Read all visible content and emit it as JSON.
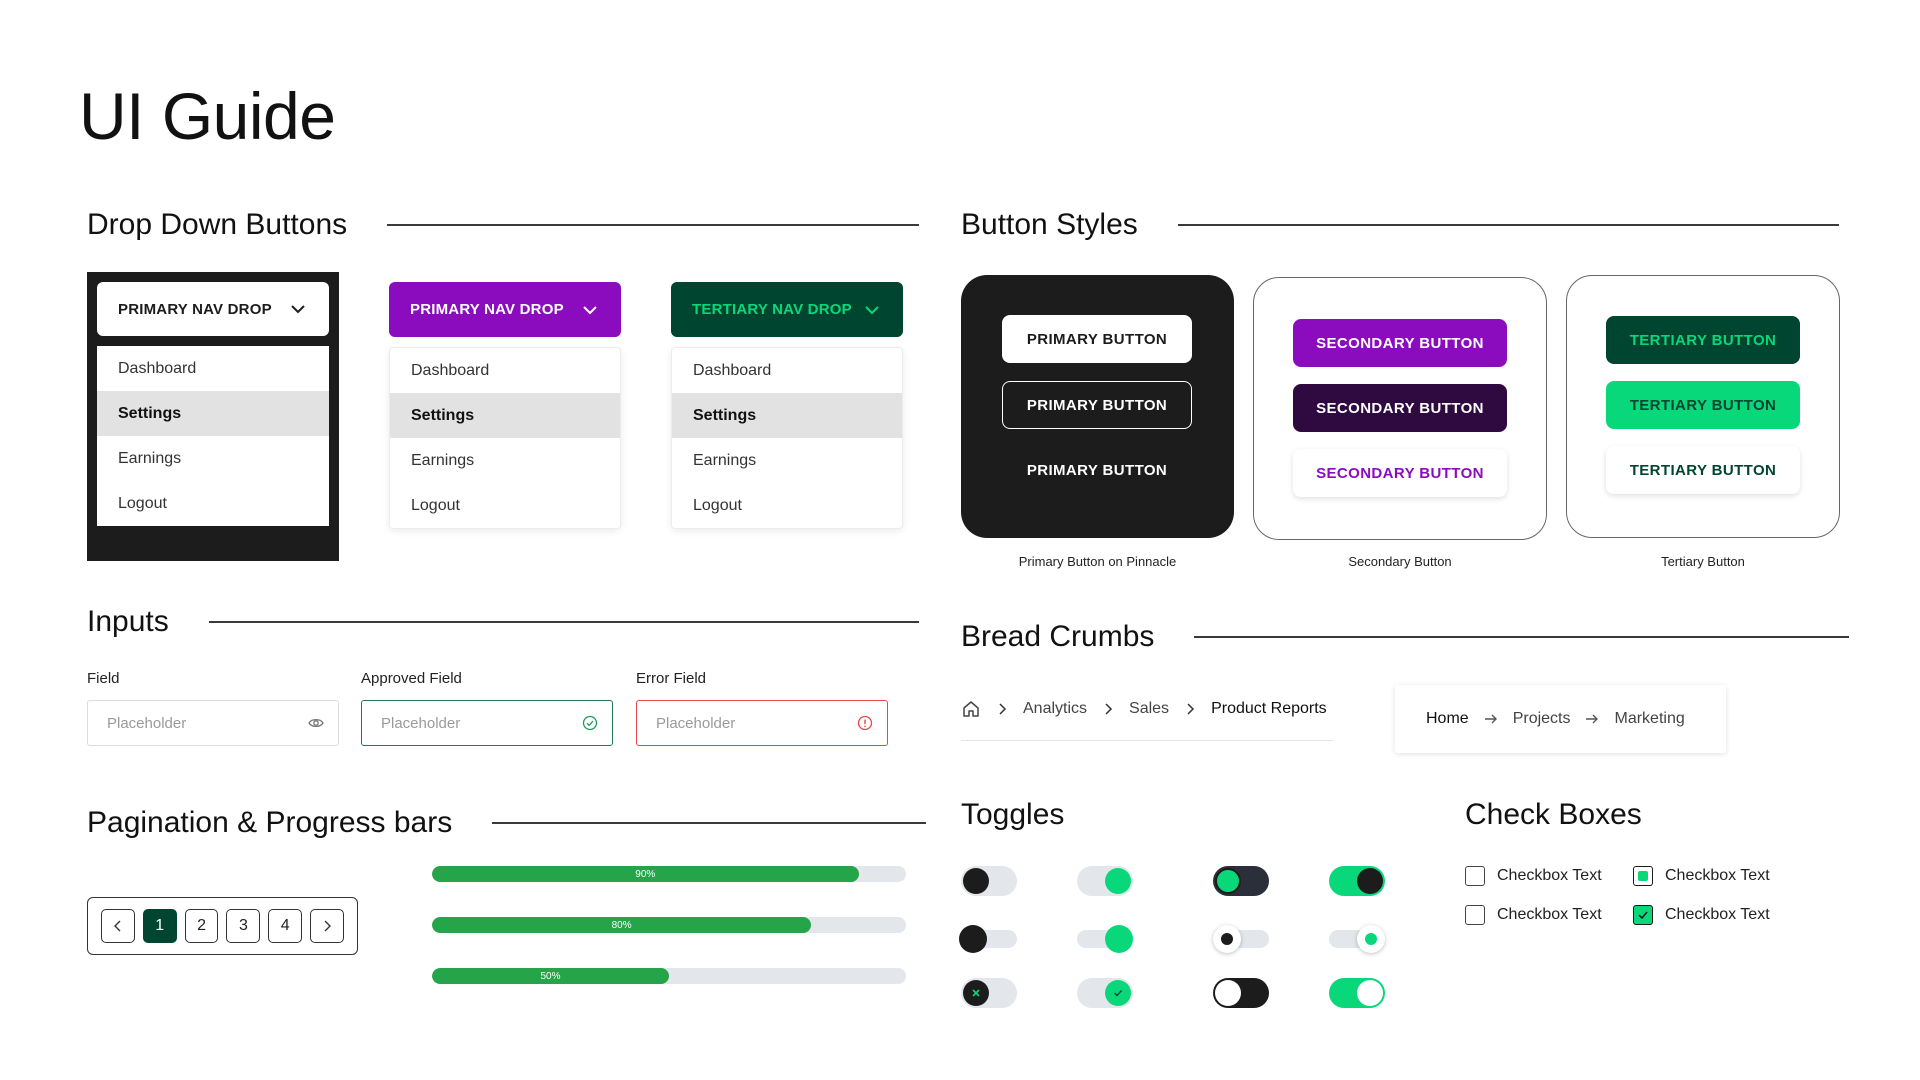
{
  "page": {
    "title": "UI Guide"
  },
  "sections": {
    "dropdowns": "Drop Down Buttons",
    "buttons": "Button Styles",
    "inputs": "Inputs",
    "breadcrumbs": "Bread Crumbs",
    "pagination": "Pagination & Progress bars",
    "toggles": "Toggles",
    "checkboxes": "Check Boxes"
  },
  "dropdowns": [
    {
      "label": "PRIMARY NAV DROP",
      "variant": "primary",
      "items": [
        "Dashboard",
        "Settings",
        "Earnings",
        "Logout"
      ],
      "active": "Settings"
    },
    {
      "label": "PRIMARY NAV DROP",
      "variant": "secondary",
      "items": [
        "Dashboard",
        "Settings",
        "Earnings",
        "Logout"
      ],
      "active": "Settings"
    },
    {
      "label": "TERTIARY NAV DROP",
      "variant": "tertiary",
      "items": [
        "Dashboard",
        "Settings",
        "Earnings",
        "Logout"
      ],
      "active": "Settings"
    }
  ],
  "button_panels": [
    {
      "caption": "Primary Button on Pinnacle",
      "buttons": [
        "PRIMARY BUTTON",
        "PRIMARY BUTTON",
        "PRIMARY BUTTON"
      ]
    },
    {
      "caption": "Secondary Button",
      "buttons": [
        "SECONDARY BUTTON",
        "SECONDARY BUTTON",
        "SECONDARY BUTTON"
      ]
    },
    {
      "caption": "Tertiary Button",
      "buttons": [
        "TERTIARY BUTTON",
        "TERTIARY BUTTON",
        "TERTIARY BUTTON"
      ]
    }
  ],
  "inputs": [
    {
      "label": "Field",
      "placeholder": "Placeholder",
      "state": "default",
      "icon": "eye-icon"
    },
    {
      "label": "Approved Field",
      "placeholder": "Placeholder",
      "state": "approved",
      "icon": "check-circle-icon"
    },
    {
      "label": "Error Field",
      "placeholder": "Placeholder",
      "state": "error",
      "icon": "alert-circle-icon"
    }
  ],
  "pagination": {
    "pages": [
      "1",
      "2",
      "3",
      "4"
    ],
    "current": "1"
  },
  "progress_bars": [
    {
      "label": "90%",
      "value": 0.9
    },
    {
      "label": "80%",
      "value": 0.8
    },
    {
      "label": "50%",
      "value": 0.5
    }
  ],
  "breadcrumbs": {
    "trail1": [
      "Analytics",
      "Sales",
      "Product Reports"
    ],
    "trail2": [
      "Home",
      "Projects",
      "Marketing"
    ]
  },
  "checkboxes": [
    {
      "label": "Checkbox Text",
      "state": "unchecked"
    },
    {
      "label": "Checkbox Text",
      "state": "indeterminate"
    },
    {
      "label": "Checkbox Text",
      "state": "unchecked"
    },
    {
      "label": "Checkbox Text",
      "state": "checked"
    }
  ],
  "colors": {
    "black": "#1c1c1c",
    "purple": "#8b0cbf",
    "dark_purple": "#2f0a40",
    "dark_green": "#00452f",
    "bright_green": "#08d87a",
    "progress_green": "#25a449",
    "error_red": "#e5484d"
  }
}
